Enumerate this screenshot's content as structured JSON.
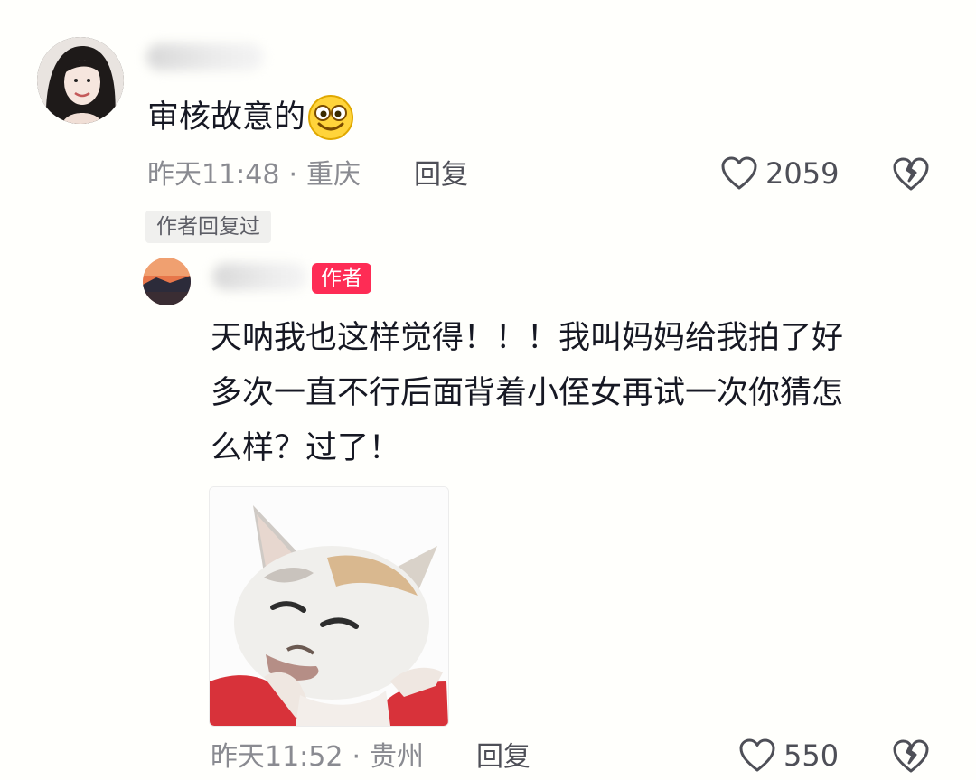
{
  "comment": {
    "text": "审核故意的",
    "emoji_icon": "smiling-face-emoji-icon",
    "time": "昨天11:48",
    "separator": "·",
    "location": "重庆",
    "reply_label": "回复",
    "like_count": "2059",
    "author_replied_tag": "作者回复过"
  },
  "reply": {
    "author_badge": "作者",
    "text_lines": [
      "天呐我也这样觉得！！！我叫妈妈给我拍了好",
      "多次一直不行后面背着小侄女再试一次你猜怎",
      "么样？过了！"
    ],
    "sticker_icon": "cat-shrug-sticker",
    "time": "昨天11:52",
    "separator": "·",
    "location": "贵州",
    "reply_label": "回复",
    "like_count": "550"
  },
  "colors": {
    "background": "#fffffc",
    "text_primary": "#161823",
    "text_secondary": "#8a8b91",
    "author_badge": "#fe2c55"
  }
}
